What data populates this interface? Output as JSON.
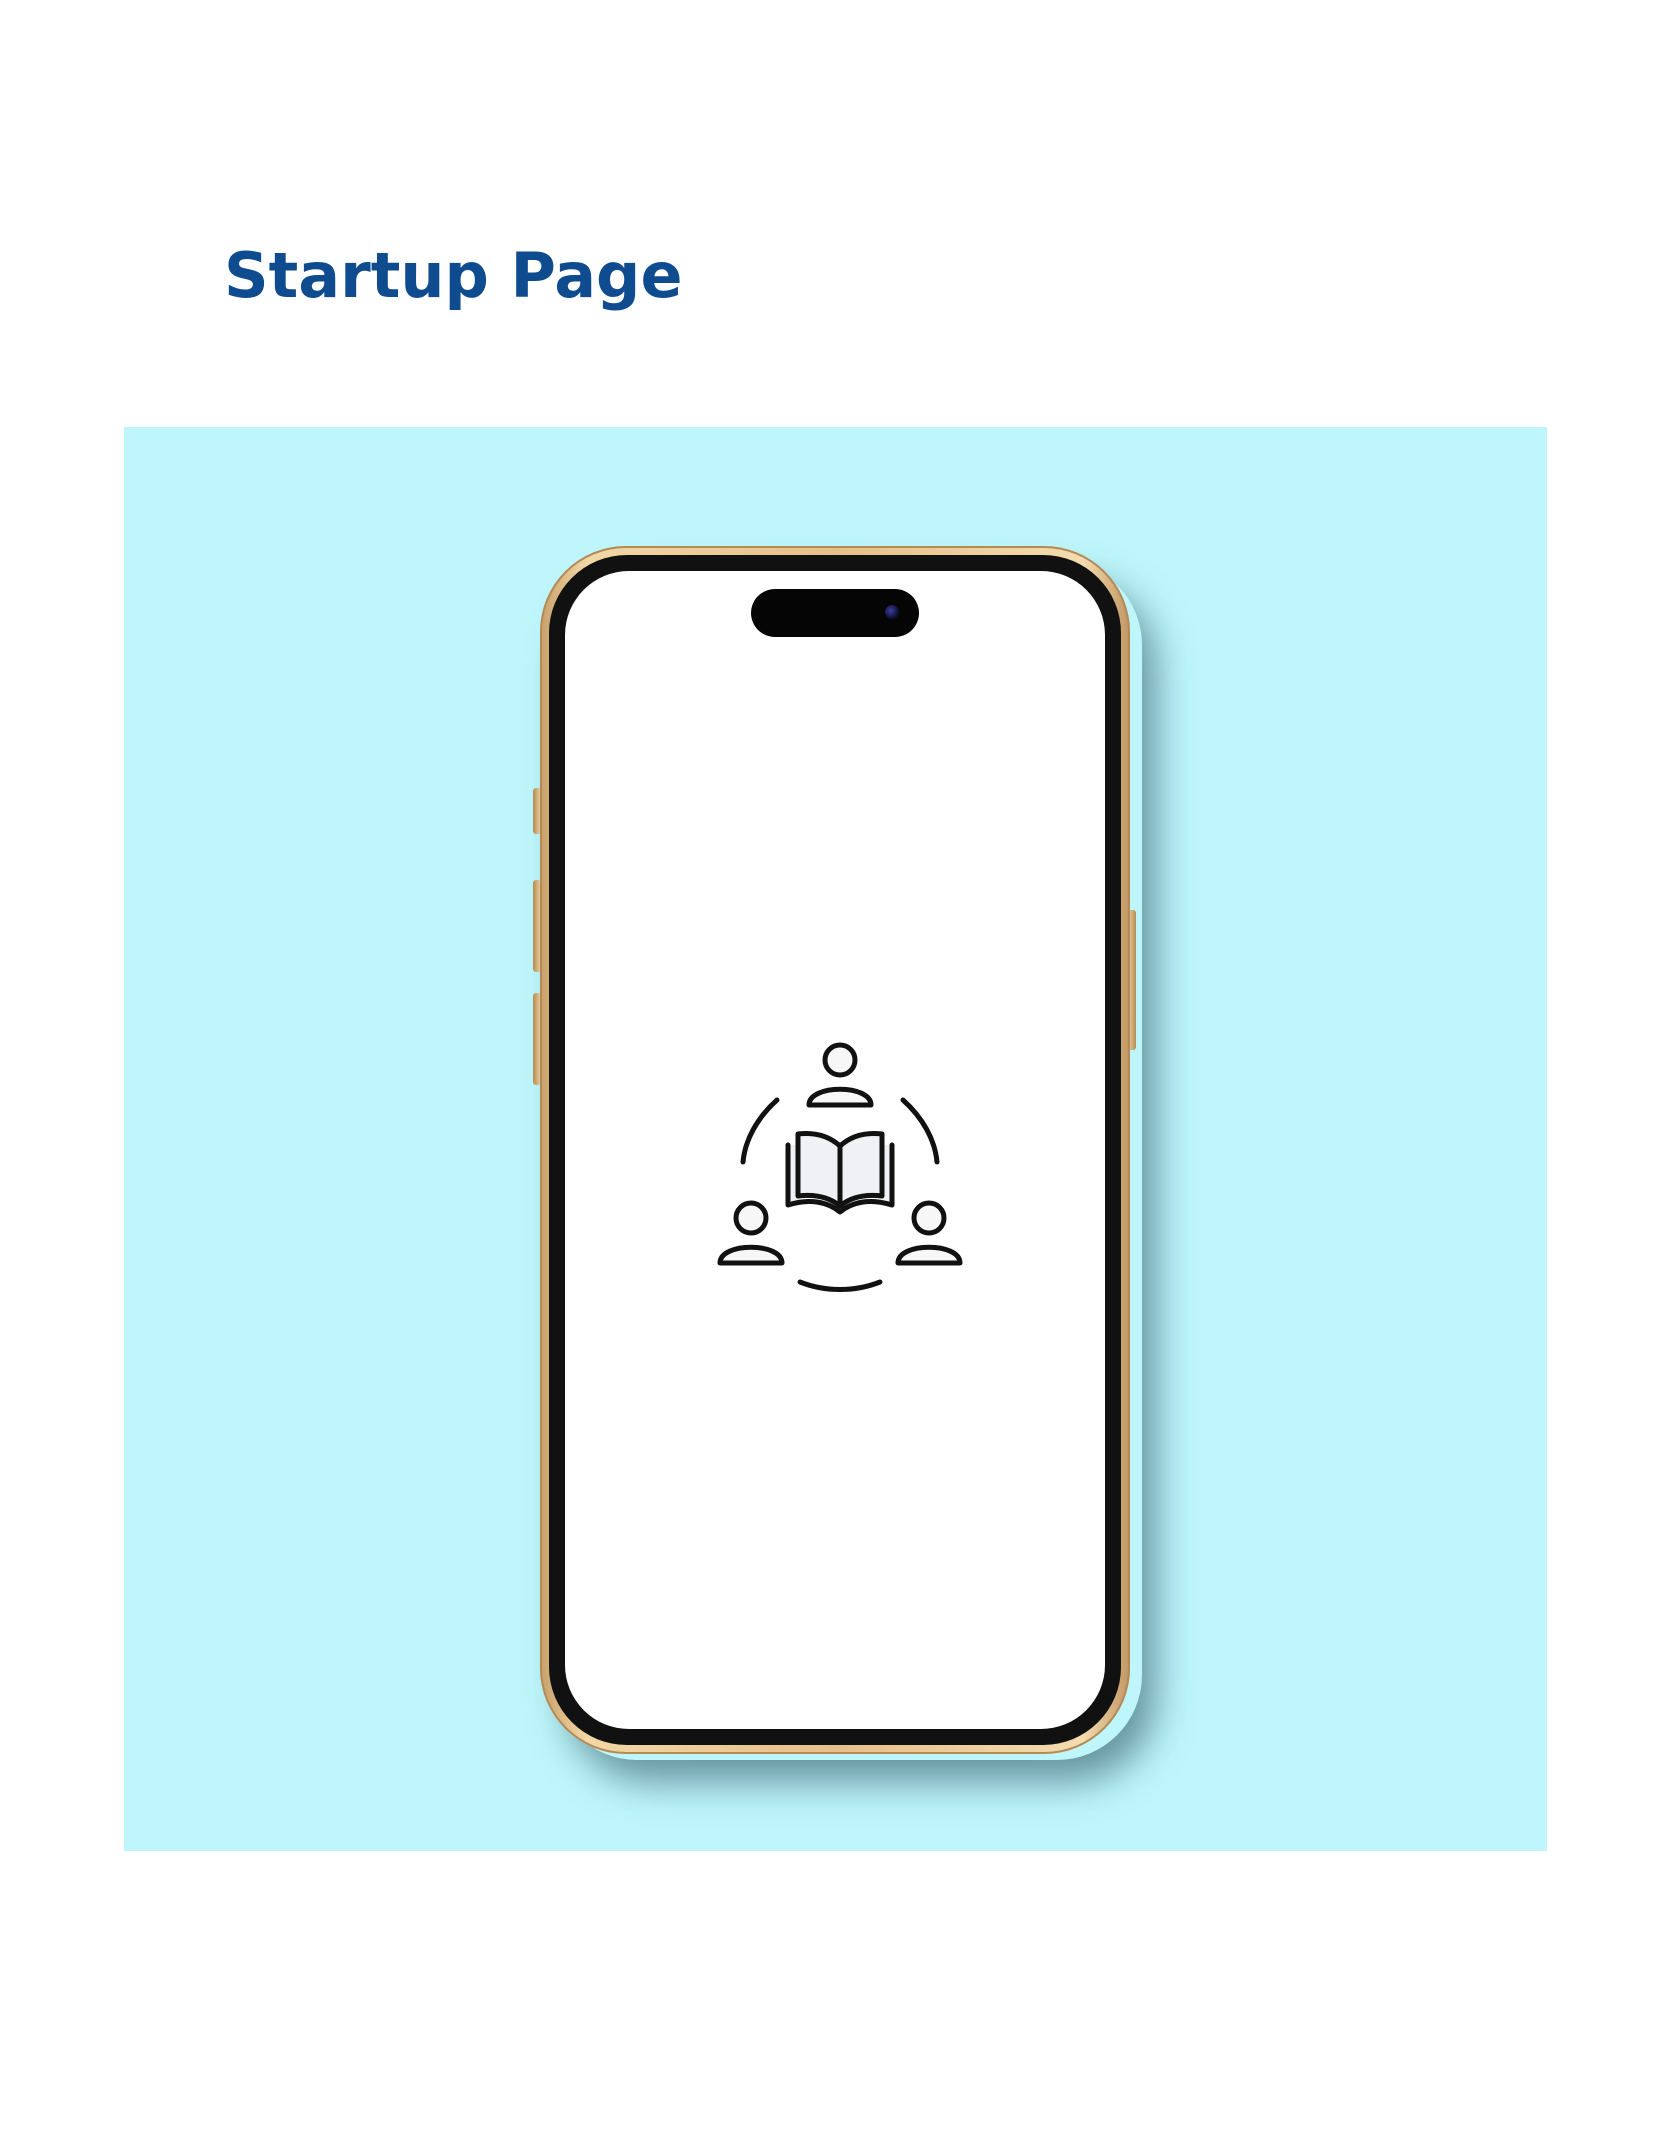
{
  "page": {
    "title": "Startup Page",
    "title_color": "#0f4b8f",
    "background_color": "#bef6fc"
  },
  "phone": {
    "frame_color": "#e6c08a",
    "screen_color": "#ffffff",
    "splash_logo_icon": "group-reading-book-icon"
  }
}
